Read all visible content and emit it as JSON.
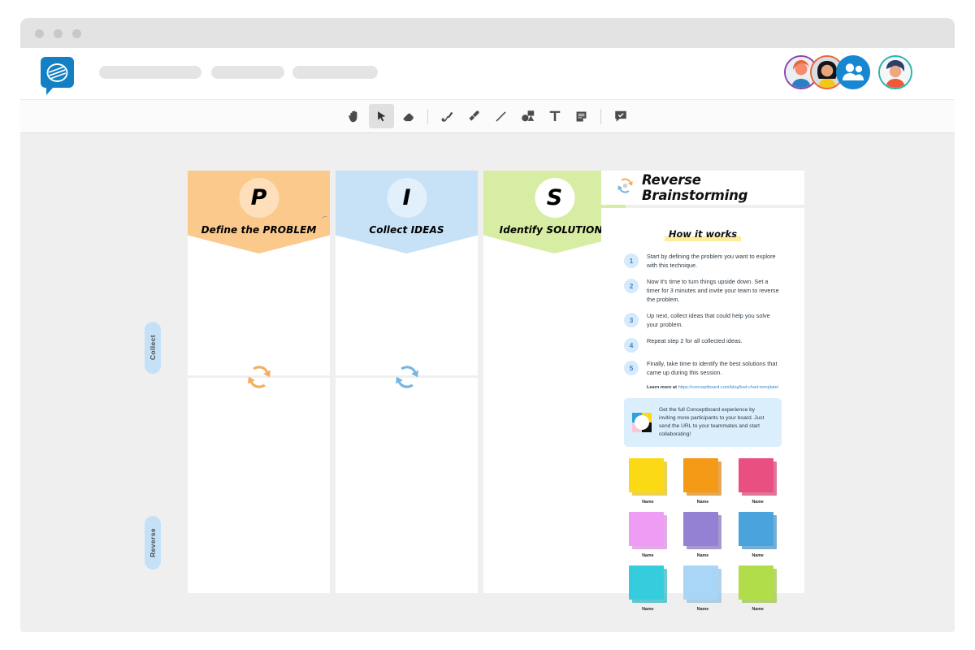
{
  "window": {
    "dots": [
      "close",
      "minimize",
      "maximize"
    ]
  },
  "header": {
    "logo_name": "conceptboard-logo",
    "nav_placeholders": [
      "",
      "",
      ""
    ],
    "avatars": [
      {
        "name": "avatar-user-1",
        "ring": "#8e44ad"
      },
      {
        "name": "avatar-user-2",
        "ring": "#e8673c"
      },
      {
        "name": "avatar-group",
        "ring": "#1887d2"
      },
      {
        "name": "avatar-user-me",
        "ring": "#2bb5b0"
      }
    ]
  },
  "toolbar": {
    "tools": [
      {
        "name": "hand-tool",
        "label": "Hand",
        "active": false
      },
      {
        "name": "select-tool",
        "label": "Select",
        "active": true
      },
      {
        "name": "eraser-tool",
        "label": "Eraser",
        "active": false
      },
      {
        "name": "pen-tool",
        "label": "Pen",
        "active": false
      },
      {
        "name": "marker-tool",
        "label": "Marker",
        "active": false
      },
      {
        "name": "line-tool",
        "label": "Line",
        "active": false
      },
      {
        "name": "shapes-tool",
        "label": "Shapes",
        "active": false
      },
      {
        "name": "text-tool",
        "label": "Text",
        "active": false
      },
      {
        "name": "sticky-tool",
        "label": "Sticky note",
        "active": false
      },
      {
        "name": "comment-tool",
        "label": "Comment",
        "active": false
      }
    ]
  },
  "board": {
    "row_labels": [
      {
        "text": "Collect"
      },
      {
        "text": "Reverse"
      }
    ],
    "columns": [
      {
        "letter": "P",
        "title": "Define the PROBLEM",
        "banner_color": "#fac98b",
        "circle_color": "#fde0bb",
        "arrow_color": "#f5ad5c"
      },
      {
        "letter": "I",
        "title": "Collect IDEAS",
        "banner_color": "#c7e2f7",
        "circle_color": "#e2f0fb",
        "arrow_color": "#77b6e3"
      },
      {
        "letter": "S",
        "title": "Identify SOLUTIONS",
        "banner_color": "#d7eda3",
        "circle_color": "#ffffff",
        "arrow_color": "#d7eda3"
      }
    ]
  },
  "panel": {
    "title": "Reverse Brainstorming",
    "logo_name": "reverse-brainstorming-icon",
    "section_heading": "How it works",
    "steps": [
      {
        "num": "1",
        "text": "Start by defining the problem you want to explore with this technique."
      },
      {
        "num": "2",
        "text": "Now it's time to turn things upside down. Set a timer for 3 minutes and invite your team to reverse the problem."
      },
      {
        "num": "3",
        "text": "Up next, collect ideas that could help you solve your problem."
      },
      {
        "num": "4",
        "text": "Repeat step 2 for all collected ideas."
      },
      {
        "num": "5",
        "text": "Finally, take time to identify the best solutions that came up during this session."
      }
    ],
    "learn_more_prefix": "Learn more at ",
    "learn_more_url": "https://conceptboard.com/blog/kwl-chart-template/",
    "promo_text": "Get the full Conceptboard experience by inviting more participants to your board. Just send the URL to your teammates and start collaborating!",
    "swatches": [
      {
        "name": "Name",
        "color": "#fbd914",
        "shadow": "#e0c012"
      },
      {
        "name": "Name",
        "color": "#f59a17",
        "shadow": "#dc8712"
      },
      {
        "name": "Name",
        "color": "#ea4f82",
        "shadow": "#d14372"
      },
      {
        "name": "Name",
        "color": "#ef9df4",
        "shadow": "#d98ade"
      },
      {
        "name": "Name",
        "color": "#9481d3",
        "shadow": "#8372bd"
      },
      {
        "name": "Name",
        "color": "#4ba3dd",
        "shadow": "#4090c5"
      },
      {
        "name": "Name",
        "color": "#35cddd",
        "shadow": "#2fb6c4"
      },
      {
        "name": "Name",
        "color": "#a9d6f7",
        "shadow": "#95c0de"
      },
      {
        "name": "Name",
        "color": "#b1dd4a",
        "shadow": "#9dc541"
      }
    ]
  }
}
